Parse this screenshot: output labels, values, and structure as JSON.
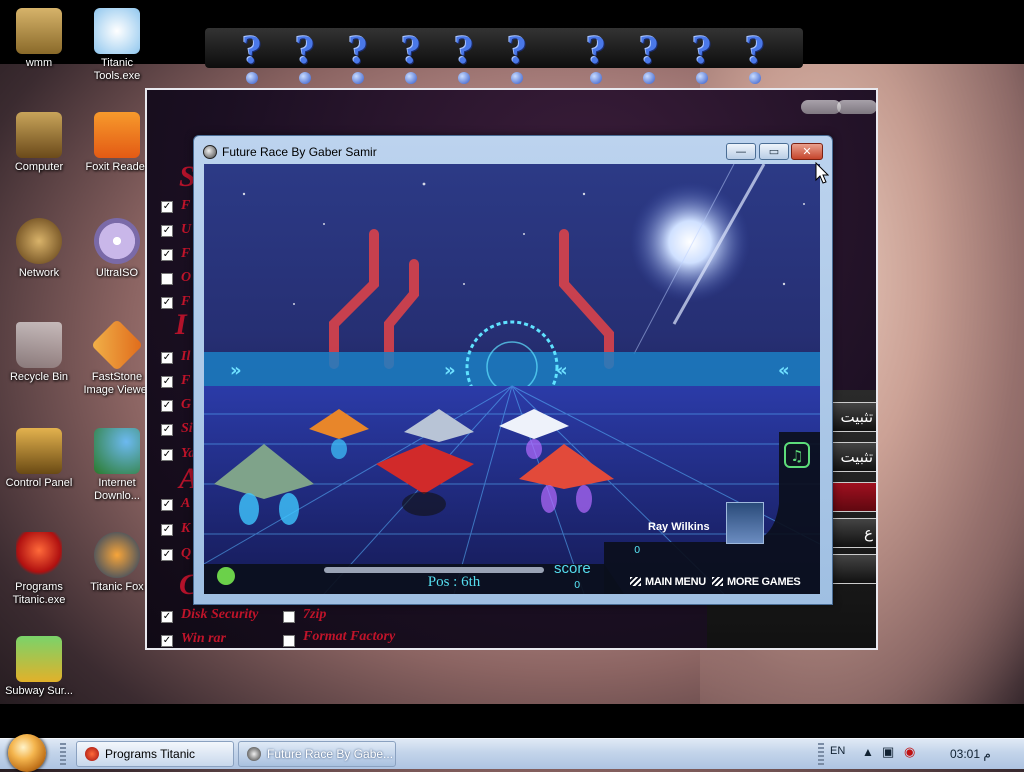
{
  "desktop": {
    "icons": [
      {
        "label": "wmm",
        "icon": "user-folder-icon"
      },
      {
        "label": "Titanic Tools.exe",
        "icon": "tools-icon"
      },
      {
        "label": "Computer",
        "icon": "computer-icon"
      },
      {
        "label": "Foxit Reader",
        "icon": "pdf-icon"
      },
      {
        "label": "Network",
        "icon": "network-icon"
      },
      {
        "label": "UltraISO",
        "icon": "disc-icon"
      },
      {
        "label": "Recycle Bin",
        "icon": "recycle-bin-icon"
      },
      {
        "label": "FastStone Image Viewer",
        "icon": "image-viewer-icon"
      },
      {
        "label": "Control Panel",
        "icon": "control-panel-icon"
      },
      {
        "label": "Internet Downlo...",
        "icon": "download-manager-icon"
      },
      {
        "label": "Programs Titanic.exe",
        "icon": "programs-icon"
      },
      {
        "label": "Titanic Fox",
        "icon": "browser-icon"
      },
      {
        "label": "Subway Sur...",
        "icon": "game-icon"
      }
    ]
  },
  "question_strip": {
    "marks": [
      "?",
      "?",
      "?",
      "?",
      "?",
      "?",
      "?",
      "?",
      "?",
      "?"
    ]
  },
  "titanic_window": {
    "letters": [
      "S",
      "I",
      "A",
      "C"
    ],
    "items": [
      "F",
      "U",
      "F",
      "O",
      "F",
      "Il",
      "F",
      "G",
      "Si",
      "Ya",
      "A",
      "K",
      "Q"
    ],
    "bottom_items": [
      {
        "label": "Disk Security",
        "checked": true
      },
      {
        "label": "Win rar",
        "checked": true
      },
      {
        "label": "7zip",
        "checked": false
      },
      {
        "label": "Format Factory",
        "checked": false
      }
    ],
    "side_buttons": [
      "تثبيت",
      "تثبيت",
      "",
      "ع",
      ""
    ]
  },
  "game_window": {
    "title": "Future Race By Gaber Samir",
    "controls": {
      "minimize": "—",
      "maximize": "▭",
      "close": "✕"
    },
    "hud": {
      "position": "Pos : 6th",
      "score_label": "score",
      "score_value": "0",
      "opponent_name": "Ray Wilkins",
      "opponent_value": "0",
      "main_menu": "MAIN MENU",
      "more_games": "MORE GAMES",
      "music_icon": "♫"
    }
  },
  "taskbar": {
    "items": [
      {
        "label": "Programs Titanic",
        "active": false
      },
      {
        "label": "Future Race By Gabe...",
        "active": true
      }
    ],
    "language": "EN",
    "clock": "03:01 م"
  },
  "colors": {
    "accent_cyan": "#55ddee",
    "titanic_red": "#c0142a",
    "taskbar": "#c3d4ea"
  }
}
